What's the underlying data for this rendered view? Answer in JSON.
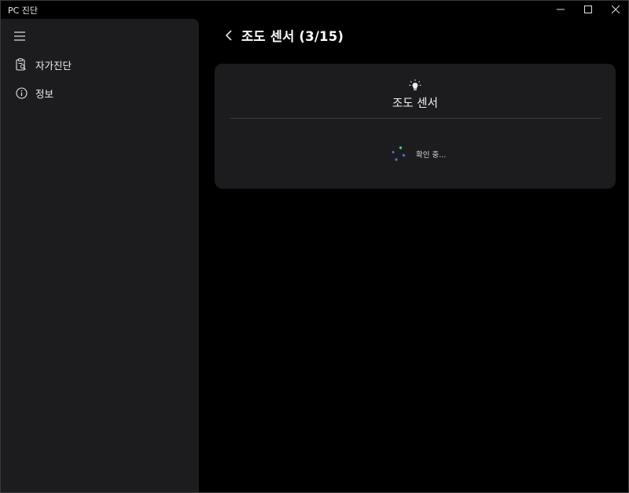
{
  "window": {
    "title": "PC 진단"
  },
  "sidebar": {
    "menu_icon": "hamburger-icon",
    "items": [
      {
        "label": "자가진단",
        "icon": "clipboard-search-icon"
      },
      {
        "label": "정보",
        "icon": "info-icon"
      }
    ]
  },
  "header": {
    "back_icon": "chevron-left-icon",
    "title": "조도 센서 (3/15)"
  },
  "card": {
    "icon": "lightbulb-icon",
    "title": "조도 센서",
    "status": "확인 중..."
  },
  "colors": {
    "background": "#000000",
    "panel": "#1c1c1e",
    "spinner_blue": "#4a78e0",
    "spinner_green": "#2fd68a"
  }
}
